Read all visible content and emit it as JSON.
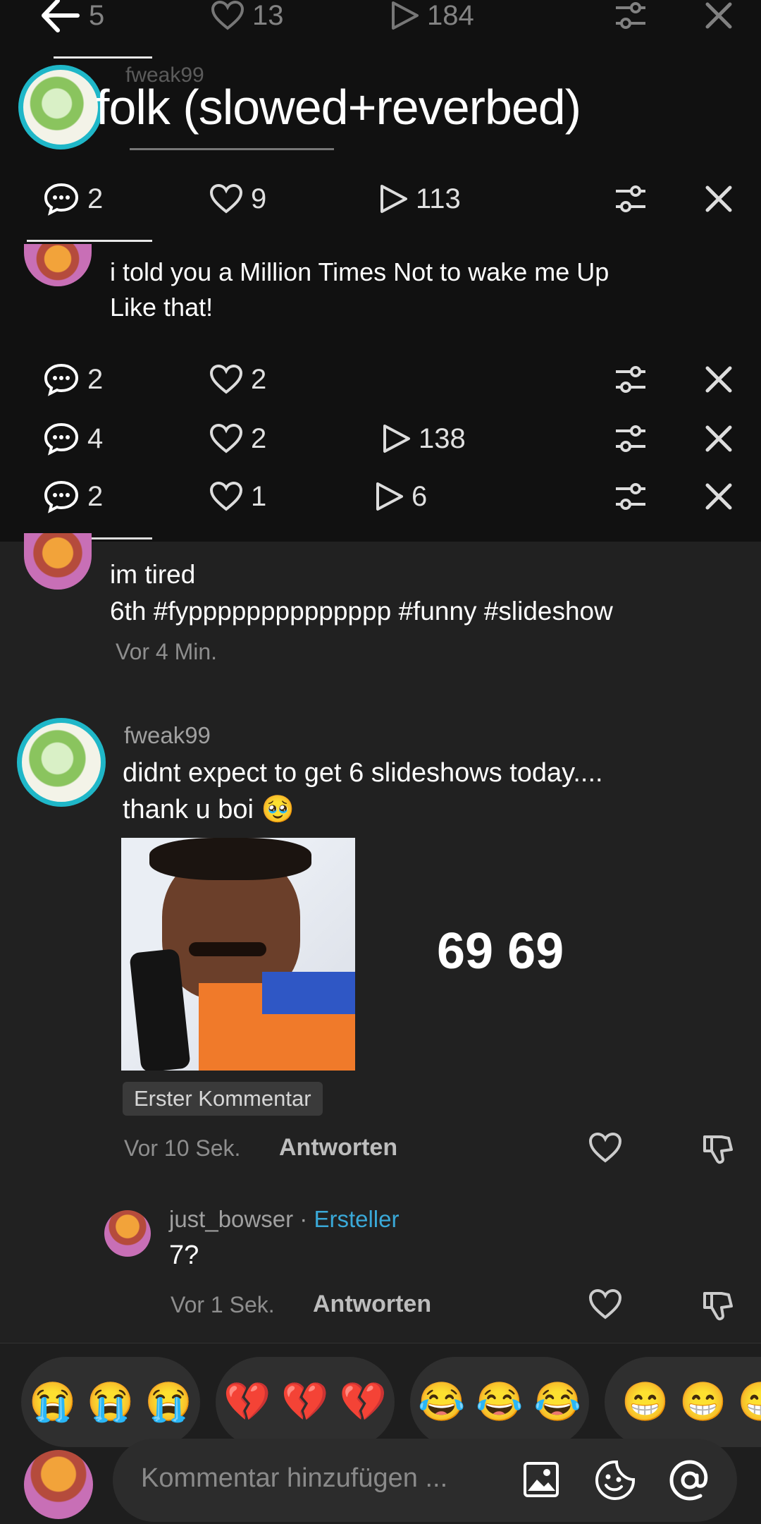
{
  "overlay": {
    "title": "folk (slowed+reverbed)",
    "ghost_name": "fweak99",
    "caption_line1": "i told you a Million Times Not to wake me Up",
    "caption_line2": "Like that!",
    "rows": [
      {
        "comments": "5",
        "likes": "13",
        "plays": "184"
      },
      {
        "comments": "2",
        "likes": "9",
        "plays": "113"
      },
      {
        "comments": "2",
        "likes": "2",
        "plays": ""
      },
      {
        "comments": "4",
        "likes": "2",
        "plays": "138"
      },
      {
        "comments": "2",
        "likes": "1",
        "plays": "6"
      }
    ]
  },
  "creator_post": {
    "line1": "im tired",
    "line2": "6th #fypppppppppppppp #funny #slideshow",
    "time": "Vor 4 Min."
  },
  "comment": {
    "username": "fweak99",
    "text_line1": "didnt expect to get 6 slideshows today....",
    "text_line2": "thank u boi 🥹",
    "sticker_text": "69 69",
    "badge": "Erster Kommentar",
    "time": "Vor 10 Sek.",
    "reply_label": "Antworten"
  },
  "reply": {
    "username": "just_bowser",
    "separator": "·",
    "role": "Ersteller",
    "text": "7?",
    "time": "Vor 1 Sek.",
    "reply_label": "Antworten"
  },
  "quick_emojis": [
    "😭 😭 😭",
    "💔 💔 💔",
    "😂 😂 😂",
    "😁 😁 😁"
  ],
  "input": {
    "placeholder": "Kommentar hinzufügen ..."
  },
  "colors": {
    "background": "#212121",
    "accent_ring": "#1fb7c8",
    "creator_tag": "#3aa9d8"
  },
  "icons": [
    "back-arrow-icon",
    "comment-icon",
    "heart-icon",
    "play-icon",
    "sliders-icon",
    "close-icon",
    "dislike-icon",
    "image-icon",
    "emoji-icon",
    "mention-icon"
  ]
}
